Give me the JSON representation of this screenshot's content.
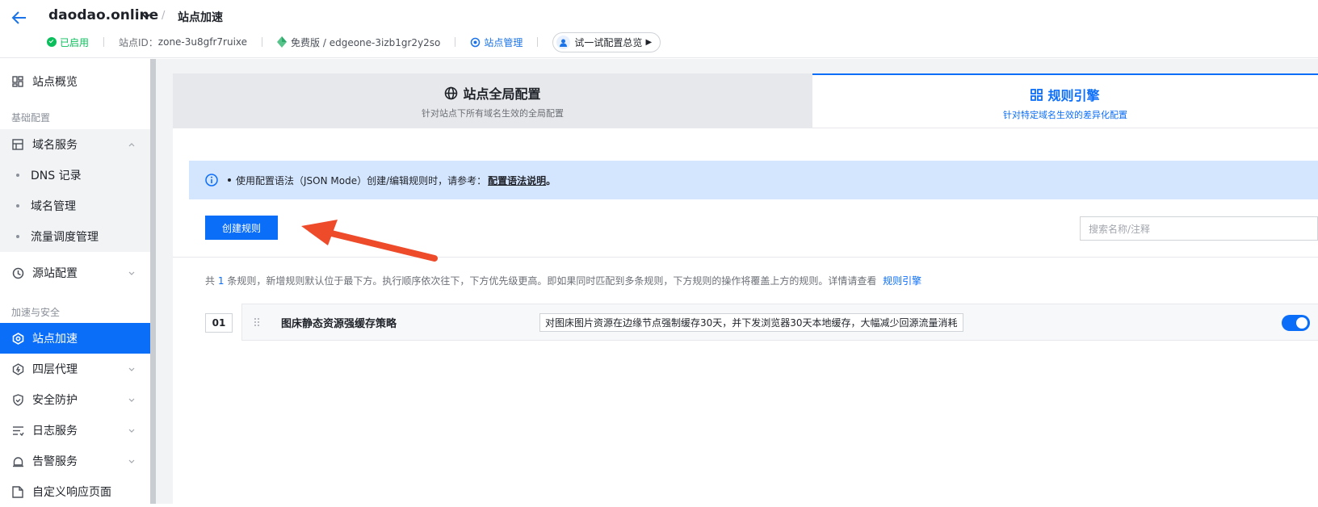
{
  "header": {
    "site_name": "daodao.online",
    "breadcrumb_sep": "/",
    "breadcrumb": "站点加速",
    "status": "已启用",
    "site_id_label": "站点ID：",
    "site_id": "zone-3u8gfr7ruixe",
    "plan": "免费版 / edgeone-3izb1gr2y2so",
    "site_mgmt": "站点管理",
    "try_config": "试一试配置总览"
  },
  "sidebar": {
    "overview": "站点概览",
    "group_basic": "基础配置",
    "domain_service": "域名服务",
    "dns": "DNS 记录",
    "domain_mgmt": "域名管理",
    "traffic": "流量调度管理",
    "origin": "源站配置",
    "group_accel": "加速与安全",
    "site_accel": "站点加速",
    "l4_proxy": "四层代理",
    "security": "安全防护",
    "logs": "日志服务",
    "alerts": "告警服务",
    "custom_page": "自定义响应页面"
  },
  "tabs": {
    "global_title": "站点全局配置",
    "global_sub": "针对站点下所有域名生效的全局配置",
    "rules_title": "规则引擎",
    "rules_sub": "针对特定域名生效的差异化配置"
  },
  "notice": {
    "text": "使用配置语法（JSON Mode）创建/编辑规则时，请参考：",
    "link": "配置语法说明",
    "end": "。"
  },
  "toolbar": {
    "create_label": "创建规则",
    "search_placeholder": "搜索名称/注释"
  },
  "summary": {
    "pre": "共",
    "count": "1",
    "post": "条规则，新增规则默认位于最下方。执行顺序依次往下，下方优先级更高。即如果同时匹配到多条规则，下方规则的操作将覆盖上方的规则。详情请查看",
    "link": "规则引擎"
  },
  "rules": [
    {
      "index": "01",
      "name": "图床静态资源强缓存策略",
      "description": "对图床图片资源在边缘节点强制缓存30天，并下发浏览器30天本地缓存，大幅减少回源流量消耗",
      "enabled": true
    }
  ],
  "colors": {
    "accent": "#0b6ef9",
    "success": "#0abf5b",
    "annotation_arrow": "#ee4b2b"
  }
}
